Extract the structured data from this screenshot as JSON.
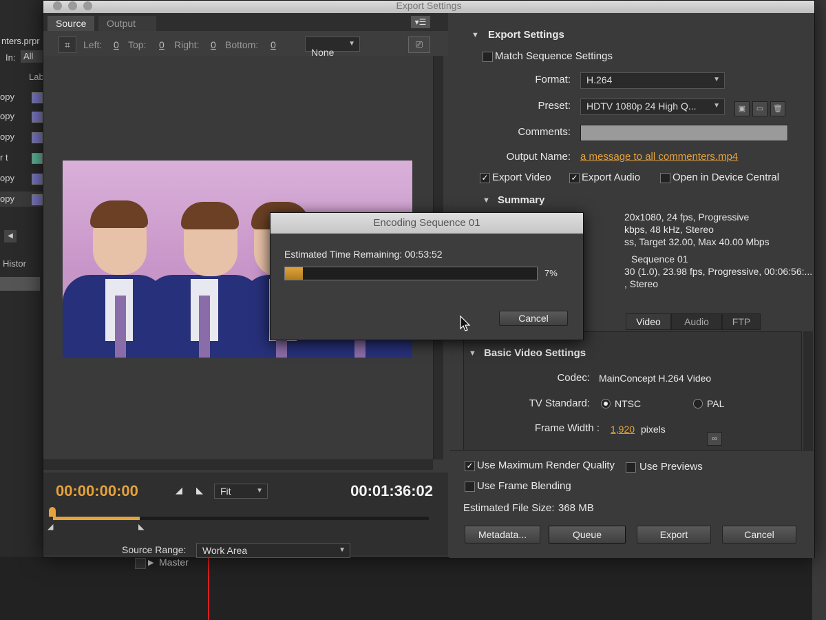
{
  "bg_project": {
    "filename": "nters.prpr",
    "in_label": "In:",
    "in_value": "All",
    "column_label": "Lab",
    "rows": [
      "opy",
      "opy",
      "opy",
      "r t",
      "opy",
      "opy"
    ],
    "row_colors": [
      "#7a78c8",
      "#7a78c8",
      "#7a78c8",
      "#5fb89a",
      "#7a78c8",
      "#7a78c8"
    ],
    "history_tab": "Histor"
  },
  "window": {
    "title": "Export Settings"
  },
  "source_tabs": {
    "source": "Source",
    "output": "Output"
  },
  "crop": {
    "left_label": "Left:",
    "left_value": "0",
    "top_label": "Top:",
    "top_value": "0",
    "right_label": "Right:",
    "right_value": "0",
    "bottom_label": "Bottom:",
    "bottom_value": "0",
    "ratio_value": "None"
  },
  "timeline": {
    "current_time": "00:00:00:00",
    "duration": "00:01:36:02",
    "zoom_value": "Fit",
    "source_range_label": "Source Range:",
    "source_range_value": "Work Area",
    "master_label": "Master"
  },
  "export_settings": {
    "header": "Export Settings",
    "match_sequence": "Match Sequence Settings",
    "format_label": "Format:",
    "format_value": "H.264",
    "preset_label": "Preset:",
    "preset_value": "HDTV 1080p 24 High Q...",
    "comments_label": "Comments:",
    "output_name_label": "Output Name:",
    "output_name_value": "a message to all commenters.mp4",
    "export_video": "Export Video",
    "export_audio": "Export Audio",
    "device_central": "Open in Device Central",
    "summary_header": "Summary",
    "summary_lines": [
      "20x1080, 24 fps, Progressive",
      "kbps, 48 kHz, Stereo",
      "ss, Target 32.00, Max 40.00 Mbps",
      "Sequence 01",
      "30 (1.0), 23.98 fps, Progressive, 00:06:56:...",
      ", Stereo"
    ]
  },
  "tabs": {
    "video": "Video",
    "audio": "Audio",
    "ftp": "FTP"
  },
  "basic_video": {
    "header": "Basic Video Settings",
    "codec_label": "Codec:",
    "codec_value": "MainConcept H.264 Video",
    "tv_standard_label": "TV Standard:",
    "ntsc": "NTSC",
    "pal": "PAL",
    "frame_width_label": "Frame Width :",
    "frame_width_value": "1,920",
    "frame_width_unit": "pixels"
  },
  "options": {
    "max_render_quality": "Use Maximum Render Quality",
    "use_previews": "Use Previews",
    "frame_blending": "Use Frame Blending",
    "file_size_label": "Estimated File Size:",
    "file_size_value": "368 MB"
  },
  "buttons": {
    "metadata": "Metadata...",
    "queue": "Queue",
    "export": "Export",
    "cancel": "Cancel"
  },
  "encoding_dialog": {
    "title": "Encoding Sequence 01",
    "time_remaining": "Estimated Time Remaining: 00:53:52",
    "percent_text": "7%",
    "progress_fraction": 0.07,
    "cancel": "Cancel"
  },
  "colors": {
    "accent": "#e6a33c",
    "playhead": "#d82020"
  }
}
